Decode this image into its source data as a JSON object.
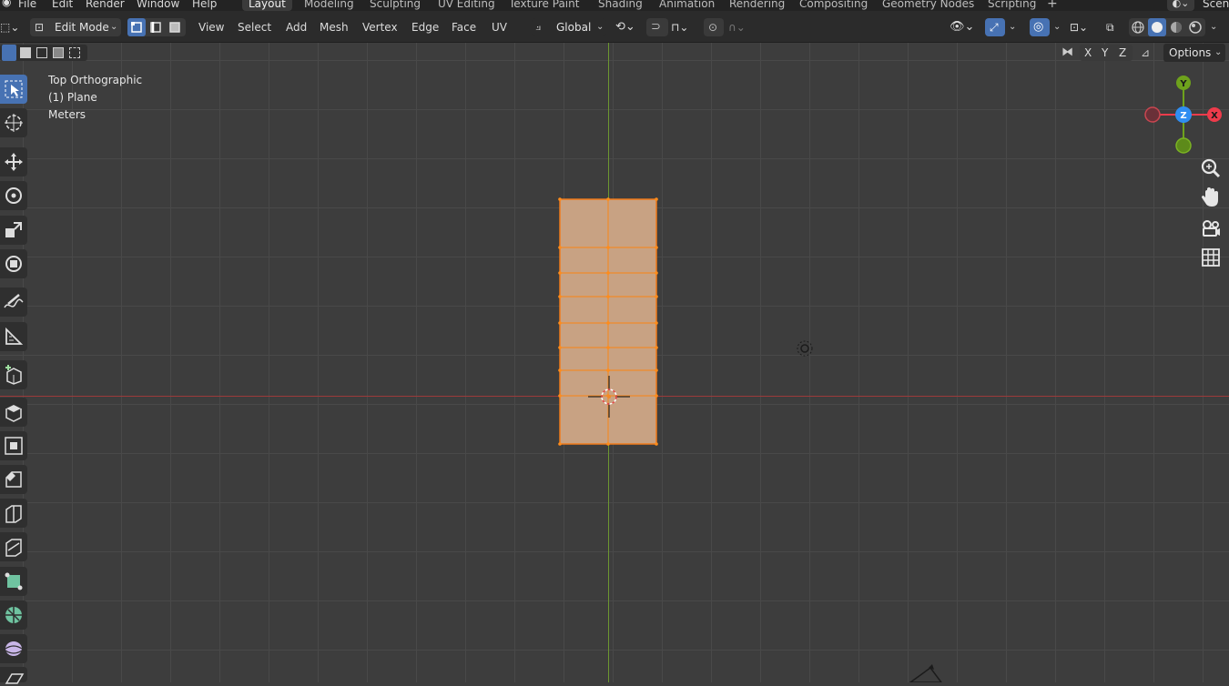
{
  "top_menu": [
    "File",
    "Edit",
    "Render",
    "Window",
    "Help"
  ],
  "workspaces": [
    "Layout",
    "Modeling",
    "Sculpting",
    "UV Editing",
    "Texture Paint",
    "Shading",
    "Animation",
    "Rendering",
    "Compositing",
    "Geometry Nodes",
    "Scripting"
  ],
  "active_workspace": "Layout",
  "scene_label": "Scen",
  "header": {
    "mode": "Edit Mode",
    "menus": [
      "View",
      "Select",
      "Add",
      "Mesh",
      "Vertex",
      "Edge",
      "Face",
      "UV"
    ],
    "transform_orientation": "Global"
  },
  "row2": {
    "axis_x": "X",
    "axis_y": "Y",
    "axis_z": "Z",
    "options": "Options"
  },
  "viewport": {
    "view_name": "Top Orthographic",
    "object": "(1) Plane",
    "units": "Meters"
  },
  "gizmo": {
    "y": "Y",
    "z": "Z",
    "x": "X"
  },
  "colors": {
    "accent": "#4772b3",
    "selection": "#f07b1a",
    "axis_x": "#ee3b4b",
    "axis_y": "#6ea21c",
    "axis_z": "#2f8ef2"
  },
  "left_tools": [
    "select-box",
    "cursor",
    "move",
    "rotate",
    "scale",
    "transform",
    "annotate",
    "measure",
    "add-cube",
    "extrude-region",
    "inset-faces",
    "bevel",
    "loop-cut",
    "knife",
    "poly-build",
    "spin",
    "smooth",
    "shear"
  ],
  "right_nav": [
    "zoom",
    "pan",
    "camera-view",
    "ortho-toggle"
  ]
}
